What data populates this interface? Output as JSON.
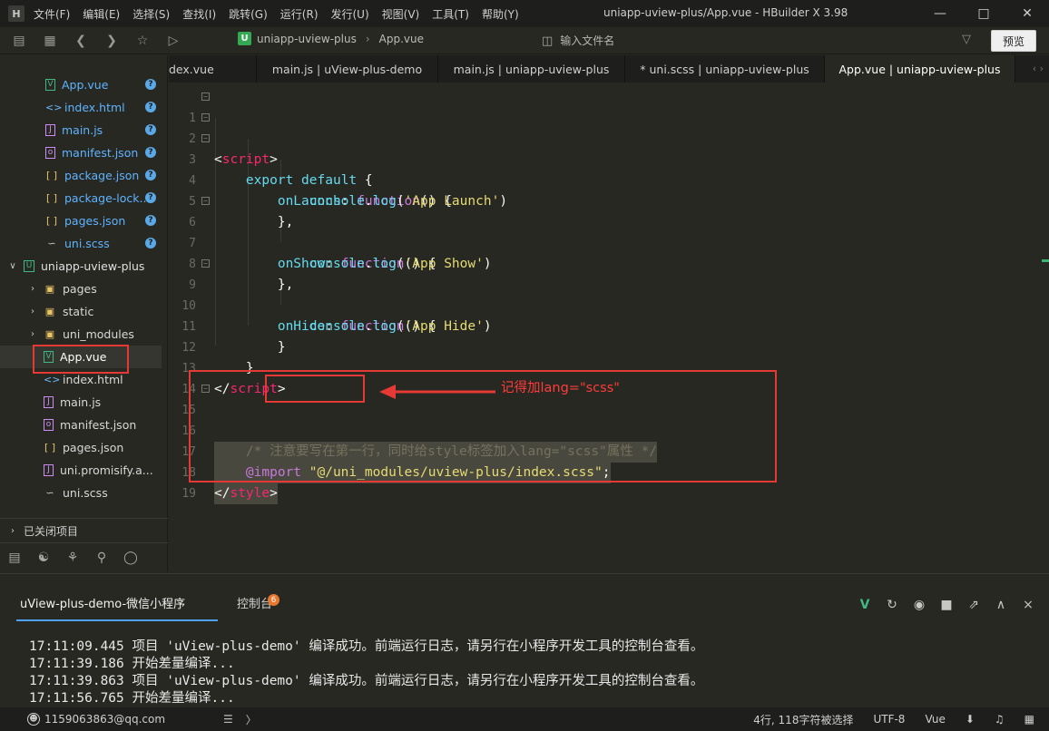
{
  "app": {
    "logo": "H",
    "window_title": "uniapp-uview-plus/App.vue - HBuilder X 3.98",
    "menu": [
      "文件(F)",
      "编辑(E)",
      "选择(S)",
      "查找(I)",
      "跳转(G)",
      "运行(R)",
      "发行(U)",
      "视图(V)",
      "工具(T)",
      "帮助(Y)"
    ]
  },
  "toolbar": {
    "breadcrumb": [
      "uniapp-uview-plus",
      "App.vue"
    ],
    "file_search_placeholder": "输入文件名",
    "preview_label": "预览"
  },
  "sidebar": {
    "top_files": [
      {
        "name": "App.vue",
        "icon": "vue-file-icon"
      },
      {
        "name": "index.html",
        "icon": "html-file-icon"
      },
      {
        "name": "main.js",
        "icon": "js-file-icon"
      },
      {
        "name": "manifest.json",
        "icon": "manifest-file-icon"
      },
      {
        "name": "package.json",
        "icon": "json-file-icon"
      },
      {
        "name": "package-lock...",
        "icon": "json-file-icon"
      },
      {
        "name": "pages.json",
        "icon": "json-file-icon"
      },
      {
        "name": "uni.scss",
        "icon": "scss-file-icon"
      }
    ],
    "project_name": "uniapp-uview-plus",
    "folders": [
      "pages",
      "static",
      "uni_modules"
    ],
    "project_files": [
      {
        "name": "App.vue",
        "icon": "vue-file-icon"
      },
      {
        "name": "index.html",
        "icon": "html-file-icon"
      },
      {
        "name": "main.js",
        "icon": "js-file-icon"
      },
      {
        "name": "manifest.json",
        "icon": "manifest-file-icon"
      },
      {
        "name": "pages.json",
        "icon": "json-file-icon"
      },
      {
        "name": "uni.promisify.a...",
        "icon": "js-file-icon"
      },
      {
        "name": "uni.scss",
        "icon": "scss-file-icon"
      }
    ],
    "closed_projects_label": "已关闭项目"
  },
  "tabs": [
    {
      "label": "dex.vue",
      "active": false
    },
    {
      "label": "main.js | uView-plus-demo",
      "active": false
    },
    {
      "label": "main.js | uniapp-uview-plus",
      "active": false
    },
    {
      "label": "* uni.scss | uniapp-uview-plus",
      "active": false
    },
    {
      "label": "App.vue | uniapp-uview-plus",
      "active": true
    }
  ],
  "editor": {
    "line_numbers": [
      "1",
      "2",
      "3",
      "4",
      "5",
      "6",
      "7",
      "8",
      "9",
      "10",
      "11",
      "12",
      "13",
      "14",
      "15",
      "16",
      "17",
      "18",
      "19"
    ]
  },
  "annotation": {
    "note": "记得加lang=\"scss\"",
    "color": "#e53935"
  },
  "panel": {
    "tab_project": "uView-plus-demo-微信小程序",
    "tab_console": "控制台",
    "console_badge": "6",
    "logs": [
      "17:11:09.445 项目 'uView-plus-demo' 编译成功。前端运行日志，请另行在小程序开发工具的控制台查看。",
      "17:11:39.186 开始差量编译...",
      "17:11:39.863 项目 'uView-plus-demo' 编译成功。前端运行日志，请另行在小程序开发工具的控制台查看。",
      "17:11:56.765 开始差量编译..."
    ]
  },
  "statusbar": {
    "user": "1159063863@qq.com",
    "selection": "4行, 118字符被选择",
    "encoding": "UTF-8",
    "language": "Vue"
  }
}
